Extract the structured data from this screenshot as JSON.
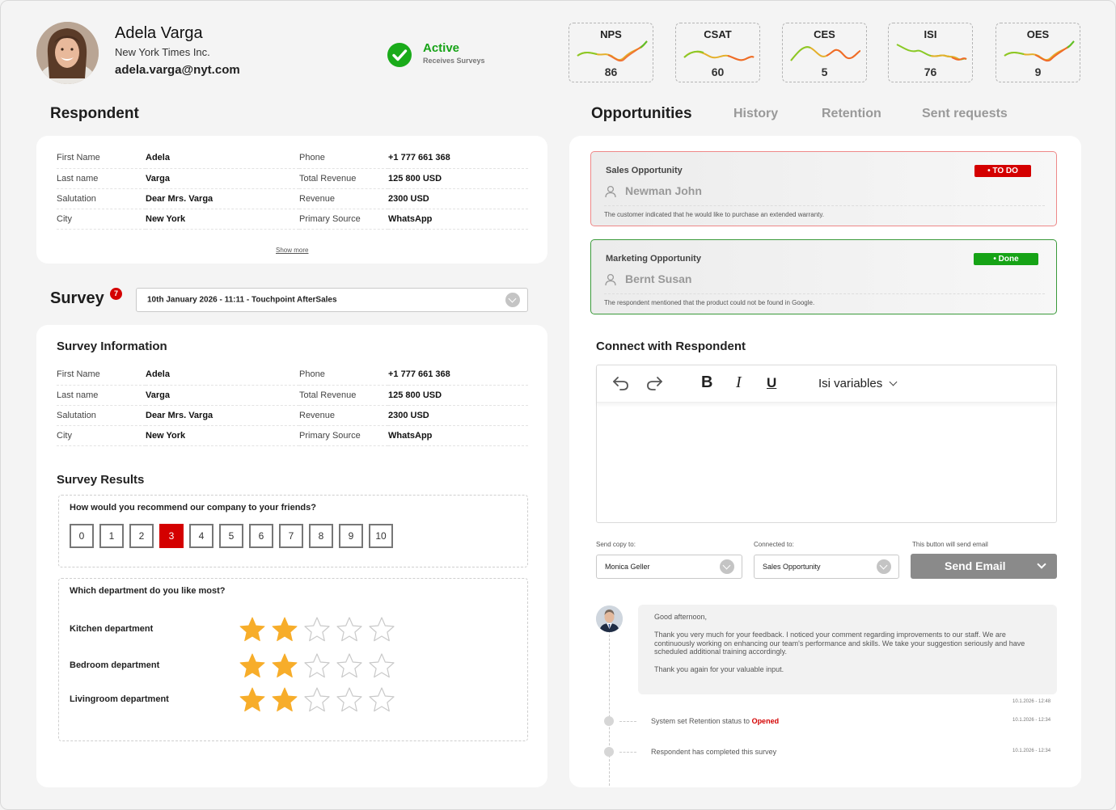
{
  "profile": {
    "name": "Adela Varga",
    "company": "New York Times Inc.",
    "email": "adela.varga@nyt.com",
    "status": "Active",
    "status_sub": "Receives Surveys"
  },
  "kpis": [
    {
      "label": "NPS",
      "value": "86"
    },
    {
      "label": "CSAT",
      "value": "60"
    },
    {
      "label": "CES",
      "value": "5"
    },
    {
      "label": "ISI",
      "value": "76"
    },
    {
      "label": "OES",
      "value": "9"
    }
  ],
  "respondent": {
    "title": "Respondent",
    "rows": [
      {
        "l1": "First Name",
        "v1": "Adela",
        "l2": "Phone",
        "v2": "+1 777 661 368"
      },
      {
        "l1": "Last name",
        "v1": "Varga",
        "l2": "Total Revenue",
        "v2": "125 800 USD"
      },
      {
        "l1": "Salutation",
        "v1": "Dear Mrs. Varga",
        "l2": "Revenue",
        "v2": "2300 USD"
      },
      {
        "l1": "City",
        "v1": "New York",
        "l2": "Primary Source",
        "v2": "WhatsApp"
      }
    ],
    "show_more": "Show more"
  },
  "survey": {
    "title": "Survey",
    "badge": "7",
    "selected": "10th January 2026 - 11:11 - Touchpoint AfterSales",
    "info_title": "Survey Information",
    "rows": [
      {
        "l1": "First Name",
        "v1": "Adela",
        "l2": "Phone",
        "v2": "+1 777 661 368"
      },
      {
        "l1": "Last name",
        "v1": "Varga",
        "l2": "Total Revenue",
        "v2": "125 800 USD"
      },
      {
        "l1": "Salutation",
        "v1": "Dear Mrs. Varga",
        "l2": "Revenue",
        "v2": "2300 USD"
      },
      {
        "l1": "City",
        "v1": "New York",
        "l2": "Primary Source",
        "v2": "WhatsApp"
      }
    ],
    "results_title": "Survey Results",
    "q1": "How would you recommend our company to your friends?",
    "scale": [
      "0",
      "1",
      "2",
      "3",
      "4",
      "5",
      "6",
      "7",
      "8",
      "9",
      "10"
    ],
    "scale_selected": "3",
    "q2": "Which department do you like most?",
    "departments": [
      {
        "name": "Kitchen department",
        "rating": 2
      },
      {
        "name": "Bedroom department",
        "rating": 2
      },
      {
        "name": "Livingroom department",
        "rating": 2
      }
    ],
    "max_rating": 5,
    "colors": {
      "star_on": "#f7ad2a",
      "star_off": "#c9c9c9",
      "selected": "#d40000"
    }
  },
  "tabs": [
    "Opportunities",
    "History",
    "Retention",
    "Sent requests"
  ],
  "opportunities": [
    {
      "title": "Sales Opportunity",
      "person": "Newman John",
      "status": "TO DO",
      "desc": "The customer indicated that he would like to purchase an extended warranty.",
      "color": "#d40000"
    },
    {
      "title": "Marketing Opportunity",
      "person": "Bernt Susan",
      "status": "Done",
      "desc": "The respondent mentioned that the product could not be found in Google.",
      "color": "#16a316"
    }
  ],
  "connect": {
    "title": "Connect with Respondent",
    "variables": "Isi variables",
    "copy_label": "Send copy to:",
    "copy_value": "Monica Geller",
    "connected_label": "Connected to:",
    "connected_value": "Sales Opportunity",
    "button_hint": "This button will send email",
    "send": "Send Email"
  },
  "timeline": {
    "message_greeting": "Good afternoon,",
    "message_body": "Thank you very much for your feedback. I noticed your comment regarding improvements to our staff. We are continuously working on enhancing our team's performance and skills. We take your suggestion seriously and have scheduled additional training accordingly.",
    "message_end": "Thank you again for your valuable input.",
    "message_time": "10.1.2026 - 12:48",
    "event1_text": "System set Retention status to ",
    "event1_status": "Opened",
    "event1_time": "10.1.2026 - 12:34",
    "event2_text": "Respondent has completed this survey",
    "event2_time": "10.1.2026 - 12:34"
  }
}
